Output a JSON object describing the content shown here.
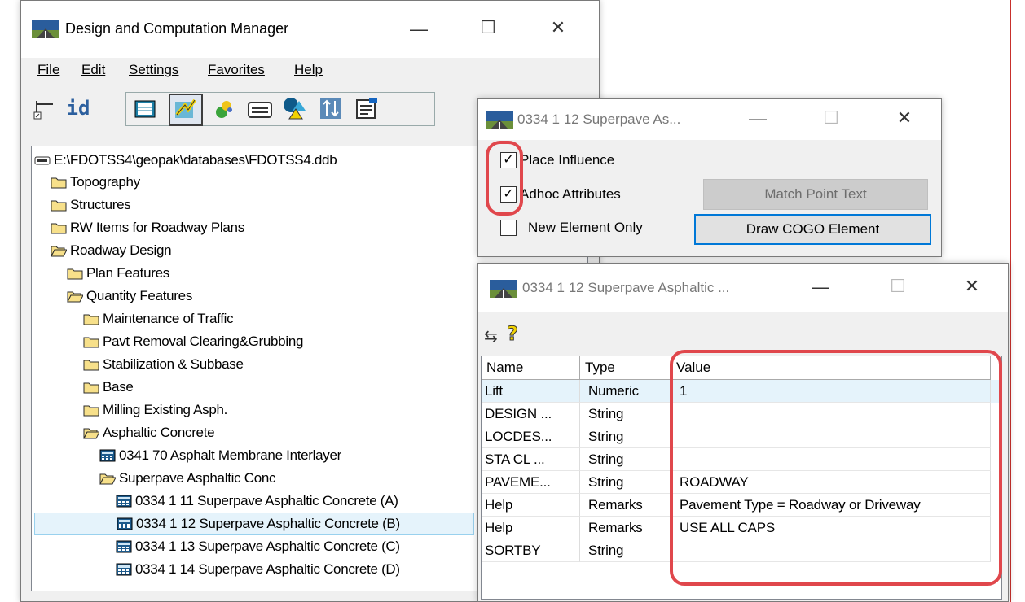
{
  "colors": {
    "highlight": "#e0474c",
    "accent": "#0078d7",
    "selection": "#e5f3fb"
  },
  "main_window": {
    "title": "Design and Computation Manager",
    "menu": {
      "file": "File",
      "edit": "Edit",
      "settings": "Settings",
      "favorites": "Favorites",
      "help": "Help"
    },
    "toolbar": {
      "id_label": "id"
    },
    "tree": {
      "root": "E:\\FDOTSS4\\geopak\\databases\\FDOTSS4.ddb",
      "items": [
        "Topography",
        "Structures",
        "RW Items for Roadway Plans",
        "Roadway Design",
        "Plan Features",
        "Quantity Features",
        "Maintenance of Traffic",
        "Pavt Removal Clearing&Grubbing",
        "Stabilization & Subbase",
        "Base",
        "Milling Existing Asph.",
        "Asphaltic Concrete",
        "0341 70 Asphalt Membrane Interlayer",
        "Superpave Asphaltic Conc",
        "0334  1 11 Superpave Asphaltic Concrete (A)",
        "0334  1 12 Superpave Asphaltic Concrete (B)",
        "0334  1 13 Superpave Asphaltic Concrete (C)",
        "0334  1 14 Superpave Asphaltic Concrete (D)"
      ]
    }
  },
  "place_dialog": {
    "title": "0334  1 12 Superpave As...",
    "place_influence": "Place Influence",
    "adhoc_attributes": "Adhoc Attributes",
    "new_element_only": "New Element Only",
    "place_influence_checked": true,
    "adhoc_attributes_checked": true,
    "new_element_only_checked": false,
    "match_point_text": "Match Point Text",
    "draw_cogo_element": "Draw COGO Element"
  },
  "attr_dialog": {
    "title": "0334  1 12 Superpave Asphaltic ...",
    "columns": {
      "name": "Name",
      "type": "Type",
      "value": "Value"
    },
    "rows": [
      {
        "name": "Lift",
        "type": "Numeric",
        "value": "1"
      },
      {
        "name": "DESIGN ...",
        "type": "String",
        "value": ""
      },
      {
        "name": "LOCDES...",
        "type": "String",
        "value": ""
      },
      {
        "name": "STA CL ...",
        "type": "String",
        "value": ""
      },
      {
        "name": "PAVEME...",
        "type": "String",
        "value": "ROADWAY"
      },
      {
        "name": "Help",
        "type": "Remarks",
        "value": "Pavement Type = Roadway or Driveway"
      },
      {
        "name": "Help",
        "type": "Remarks",
        "value": "USE ALL CAPS"
      },
      {
        "name": "SORTBY",
        "type": "String",
        "value": ""
      }
    ]
  },
  "window_controls": {
    "minimize": "—",
    "maximize": "☐",
    "close": "✕"
  }
}
